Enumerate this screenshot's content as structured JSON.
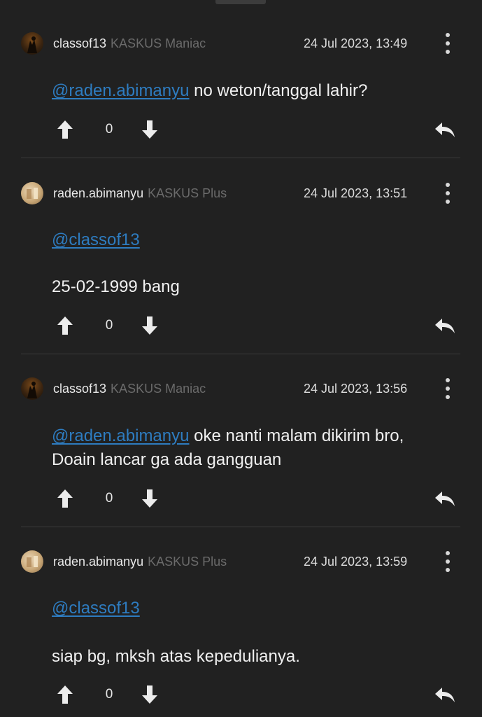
{
  "comments": [
    {
      "username": "classof13",
      "rank": "KASKUS Maniac",
      "timestamp": "24 Jul 2023, 13:49",
      "mention": "@raden.abimanyu",
      "text_inline": " no weton/tanggal lahir?",
      "text_block": "",
      "votes": "0",
      "avatar": "dark"
    },
    {
      "username": "raden.abimanyu",
      "rank": "KASKUS Plus",
      "timestamp": "24 Jul 2023, 13:51",
      "mention": "@classof13",
      "text_inline": "",
      "text_block": "25-02-1999 bang",
      "votes": "0",
      "avatar": "light"
    },
    {
      "username": "classof13",
      "rank": "KASKUS Maniac",
      "timestamp": "24 Jul 2023, 13:56",
      "mention": "@raden.abimanyu",
      "text_inline": " oke nanti malam dikirim bro, Doain lancar ga ada gangguan",
      "text_block": "",
      "votes": "0",
      "avatar": "dark"
    },
    {
      "username": "raden.abimanyu",
      "rank": "KASKUS Plus",
      "timestamp": "24 Jul 2023, 13:59",
      "mention": "@classof13",
      "text_inline": "",
      "text_block": "siap bg, mksh atas kepedulianya.",
      "votes": "0",
      "avatar": "light"
    }
  ],
  "colors": {
    "background": "#212121",
    "mention": "#2e7cc0",
    "rank": "#6b6b6b",
    "divider": "#3a3a3a"
  }
}
